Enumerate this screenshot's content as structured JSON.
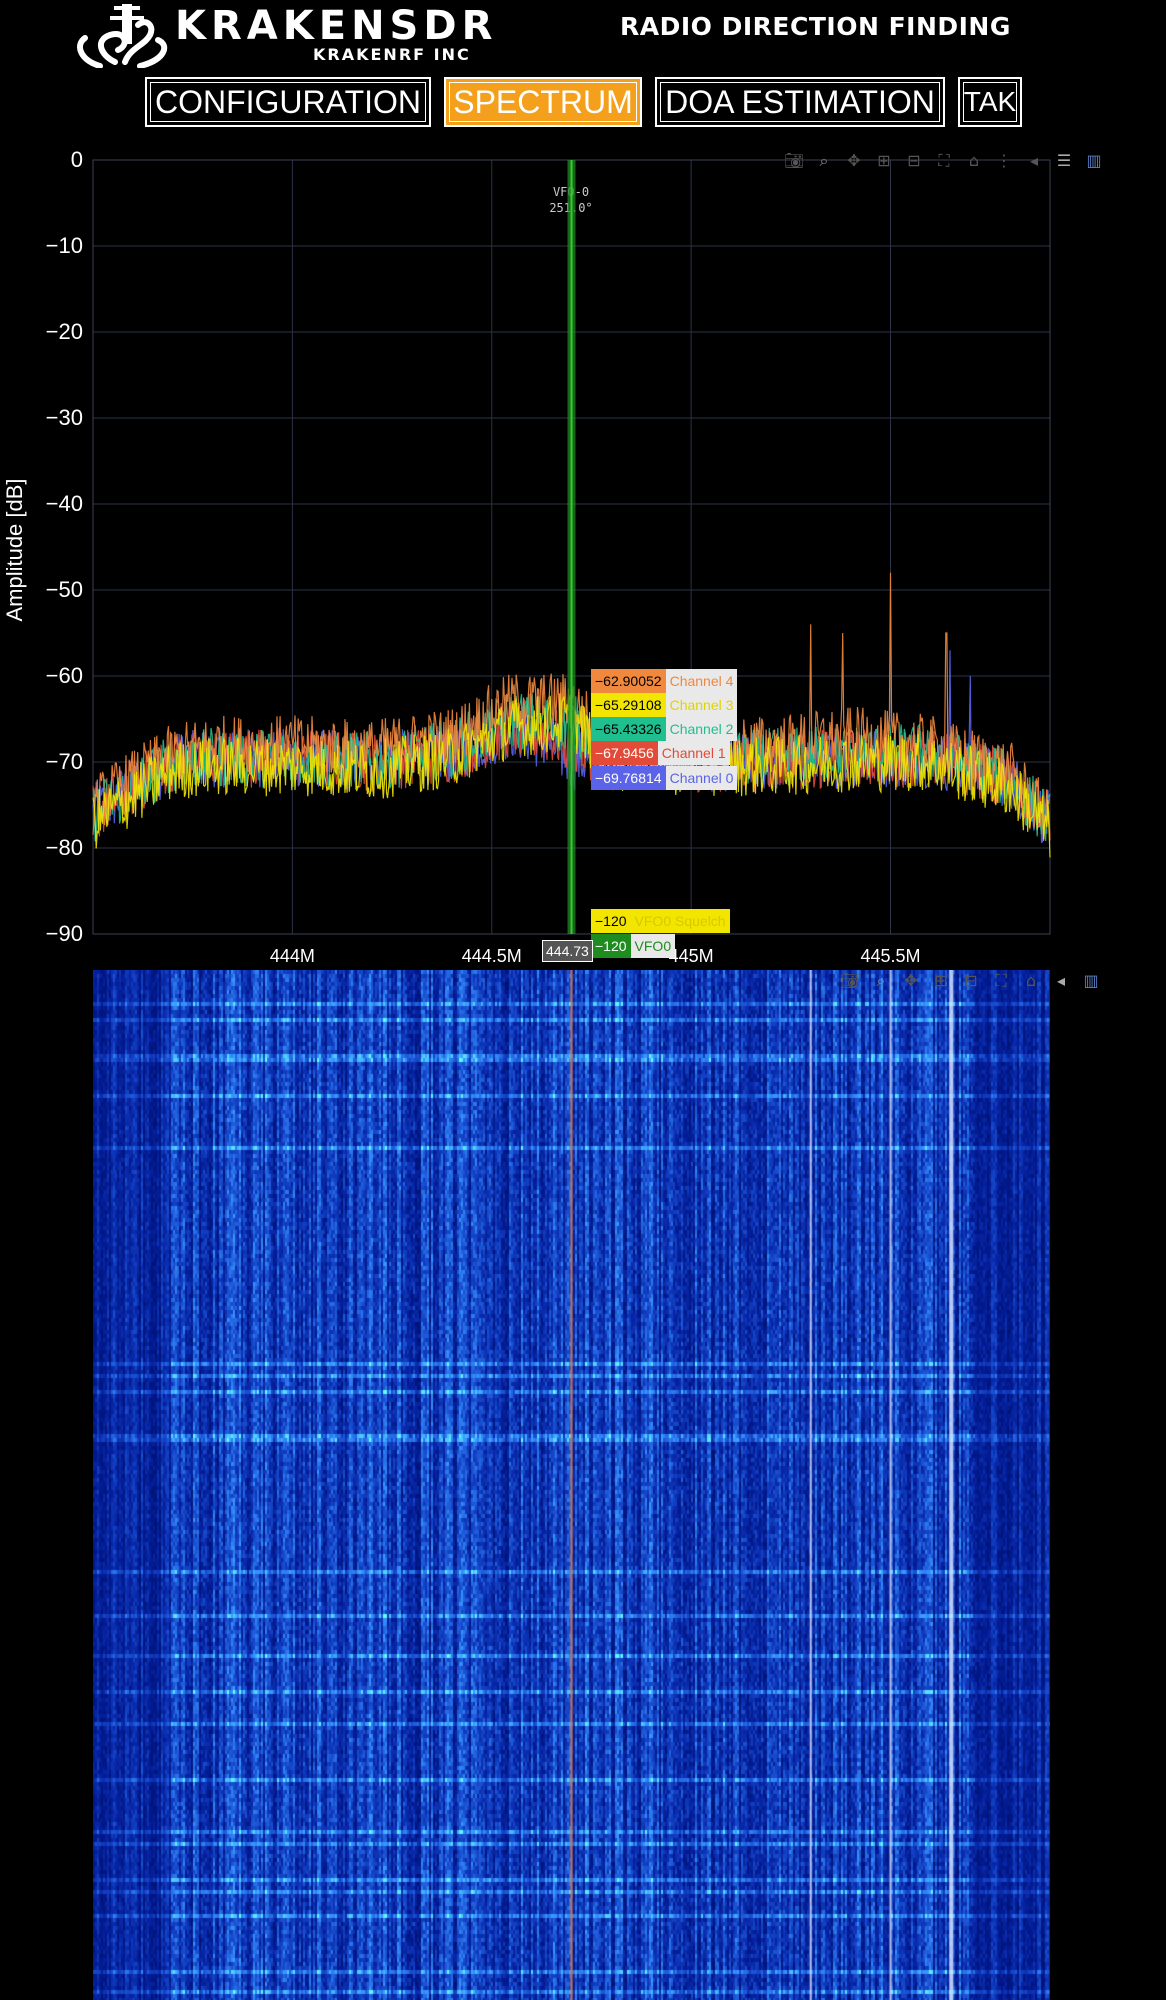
{
  "header": {
    "logo_main": "KRAKENSDR",
    "logo_sub": "KRAKENRF INC",
    "app_title": "RADIO DIRECTION FINDING"
  },
  "nav": {
    "tabs": [
      {
        "label": "CONFIGURATION",
        "active": false
      },
      {
        "label": "SPECTRUM",
        "active": true
      },
      {
        "label": "DOA ESTIMATION",
        "active": false
      },
      {
        "label": "TAK",
        "active": false
      }
    ]
  },
  "modebar_icons": [
    "camera-icon",
    "zoom-icon",
    "pan-icon",
    "zoom-in-icon",
    "zoom-out-icon",
    "autoscale-icon",
    "reset-axes-icon",
    "spike-lines-icon",
    "hover-closest-icon",
    "hover-compare-icon",
    "plotly-logo-icon"
  ],
  "colors": {
    "background": "#000000",
    "grid": "#2b3346",
    "active_tab": "#f4a01c",
    "vfo": "#1f8c1f",
    "channel_4": "#f0883e",
    "channel_3": "#f2e600",
    "channel_2": "#1fbf8f",
    "channel_1": "#e24b37",
    "channel_0": "#5b64e8",
    "waterfall_base": "#0a1a8a"
  },
  "vfo_annotation": {
    "name": "VFO-0",
    "bearing": "251.0°"
  },
  "hover": {
    "x_label": "444.73",
    "channels": [
      {
        "value": "−62.90052",
        "name": "Channel 4"
      },
      {
        "value": "−65.29108",
        "name": "Channel 3"
      },
      {
        "value": "−65.43326",
        "name": "Channel 2"
      },
      {
        "value": "−67.9456",
        "name": "Channel 1"
      },
      {
        "value": "−69.76814",
        "name": "Channel 0"
      }
    ],
    "squelch": {
      "value": "−120",
      "name": "VFO0 Squelch"
    },
    "vfo": {
      "value": "−120",
      "name": "VFO0"
    }
  },
  "chart_data": {
    "type": "line",
    "title": "",
    "xlabel": "",
    "ylabel": "Amplitude [dB]",
    "xlim": [
      443.5,
      445.9
    ],
    "ylim": [
      -90,
      0
    ],
    "x_ticks": [
      444.0,
      444.5,
      445.0,
      445.5
    ],
    "x_tick_labels": [
      "444M",
      "444.5M",
      "445M",
      "445.5M"
    ],
    "y_ticks": [
      0,
      -10,
      -20,
      -30,
      -40,
      -50,
      -60,
      -70,
      -80,
      -90
    ],
    "y_tick_labels": [
      "0",
      "−10",
      "−20",
      "−30",
      "−40",
      "−50",
      "−60",
      "−70",
      "−80",
      "−90"
    ],
    "grid": true,
    "vfo_frequency": 444.7,
    "series": [
      {
        "name": "Channel 4",
        "x": [
          443.5,
          443.6,
          443.7,
          443.8,
          444.0,
          444.2,
          444.4,
          444.55,
          444.65,
          444.7,
          444.8,
          445.0,
          445.2,
          445.4,
          445.6,
          445.8,
          445.9
        ],
        "values": [
          -75,
          -72,
          -69,
          -68,
          -68,
          -68.5,
          -67,
          -63,
          -63,
          -63,
          -68,
          -68,
          -68,
          -67,
          -68,
          -71,
          -77
        ],
        "spikes": [
          [
            445.3,
            -54
          ],
          [
            445.38,
            -55
          ],
          [
            445.5,
            -48
          ],
          [
            445.64,
            -55
          ]
        ]
      },
      {
        "name": "Channel 3",
        "x": [
          443.5,
          443.6,
          443.7,
          443.8,
          444.0,
          444.2,
          444.4,
          444.55,
          444.65,
          444.7,
          444.8,
          445.0,
          445.2,
          445.4,
          445.6,
          445.8,
          445.9
        ],
        "values": [
          -77,
          -74,
          -71,
          -70.5,
          -70.5,
          -71,
          -69.5,
          -66,
          -65.5,
          -65,
          -70,
          -70.5,
          -70.5,
          -70,
          -70,
          -73,
          -78
        ]
      },
      {
        "name": "Channel 2",
        "x": [
          443.5,
          443.6,
          443.7,
          443.8,
          444.0,
          444.2,
          444.4,
          444.55,
          444.65,
          444.7,
          444.8,
          445.0,
          445.2,
          445.4,
          445.6,
          445.8,
          445.9
        ],
        "values": [
          -76,
          -73,
          -70,
          -69.5,
          -69.5,
          -70,
          -68.5,
          -65,
          -65.5,
          -65.4,
          -69,
          -69.5,
          -69.5,
          -69,
          -69,
          -72,
          -77
        ]
      },
      {
        "name": "Channel 1",
        "x": [
          443.5,
          443.6,
          443.7,
          443.8,
          444.0,
          444.2,
          444.4,
          444.55,
          444.65,
          444.7,
          444.8,
          445.0,
          445.2,
          445.4,
          445.6,
          445.8,
          445.9
        ],
        "values": [
          -76,
          -73,
          -70,
          -69.5,
          -69.5,
          -70,
          -69,
          -66,
          -67,
          -67.9,
          -69.5,
          -70,
          -70,
          -69.5,
          -69.5,
          -72,
          -77
        ]
      },
      {
        "name": "Channel 0",
        "x": [
          443.5,
          443.6,
          443.7,
          443.8,
          444.0,
          444.2,
          444.4,
          444.55,
          444.65,
          444.7,
          444.8,
          445.0,
          445.2,
          445.4,
          445.6,
          445.8,
          445.9
        ],
        "values": [
          -76,
          -73,
          -70,
          -69.5,
          -69.5,
          -70,
          -69,
          -66,
          -68,
          -69.8,
          -69.5,
          -70,
          -70,
          -69.5,
          -69.5,
          -72,
          -77
        ],
        "spikes": [
          [
            445.65,
            -57
          ],
          [
            445.7,
            -60
          ]
        ]
      }
    ],
    "waterfall": {
      "type": "heatmap",
      "colorscale": "blue",
      "bright_lines": [
        444.7,
        445.3,
        445.5,
        445.65
      ]
    }
  }
}
